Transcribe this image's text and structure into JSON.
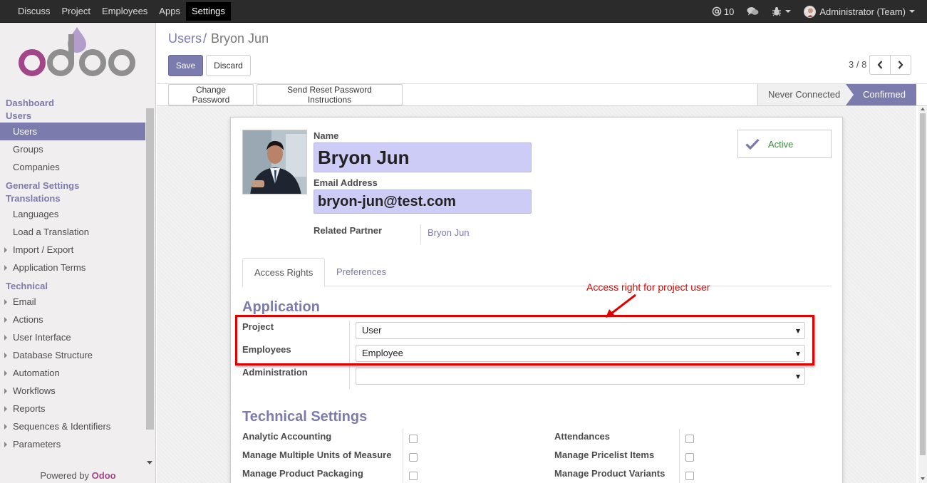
{
  "topbar": {
    "menu": [
      "Discuss",
      "Project",
      "Employees",
      "Apps",
      "Settings"
    ],
    "active_menu": "Settings",
    "messages_count": "10",
    "user": "Administrator (Team)"
  },
  "sidebar": {
    "sections": [
      {
        "title": "Dashboard",
        "items": []
      },
      {
        "title": "Users",
        "items": [
          {
            "label": "Users",
            "active": true
          },
          {
            "label": "Groups"
          },
          {
            "label": "Companies"
          }
        ]
      },
      {
        "title": "General Settings",
        "items": []
      },
      {
        "title": "Translations",
        "items": [
          {
            "label": "Languages"
          },
          {
            "label": "Load a Translation"
          },
          {
            "label": "Import / Export",
            "expandable": true
          },
          {
            "label": "Application Terms",
            "expandable": true
          }
        ]
      },
      {
        "title": "Technical",
        "items": [
          {
            "label": "Email",
            "expandable": true
          },
          {
            "label": "Actions",
            "expandable": true
          },
          {
            "label": "User Interface",
            "expandable": true
          },
          {
            "label": "Database Structure",
            "expandable": true
          },
          {
            "label": "Automation",
            "expandable": true
          },
          {
            "label": "Workflows",
            "expandable": true
          },
          {
            "label": "Reports",
            "expandable": true
          },
          {
            "label": "Sequences & Identifiers",
            "expandable": true
          },
          {
            "label": "Parameters",
            "expandable": true
          }
        ]
      }
    ],
    "powered_prefix": "Powered by",
    "powered_brand": "Odoo"
  },
  "control_panel": {
    "breadcrumb_parent": "Users",
    "breadcrumb_sep": "/",
    "breadcrumb_current": "Bryon Jun",
    "save_label": "Save",
    "discard_label": "Discard",
    "pager": "3 / 8"
  },
  "header": {
    "change_password": "Change Password",
    "send_reset": "Send Reset Password Instructions",
    "stage_never": "Never Connected",
    "stage_confirmed": "Confirmed"
  },
  "form": {
    "name_label": "Name",
    "name_value": "Bryon Jun",
    "email_label": "Email Address",
    "email_value": "bryon-jun@test.com",
    "partner_label": "Related Partner",
    "partner_value": "Bryon Jun",
    "active_label": "Active",
    "tabs": [
      "Access Rights",
      "Preferences"
    ],
    "application_title": "Application",
    "project_label": "Project",
    "project_value": "User",
    "employees_label": "Employees",
    "employees_value": "Employee",
    "administration_label": "Administration",
    "administration_value": "",
    "technical_title": "Technical Settings",
    "technical_left": [
      "Analytic Accounting",
      "Manage Multiple Units of Measure",
      "Manage Product Packaging"
    ],
    "technical_right": [
      "Attendances",
      "Manage Pricelist Items",
      "Manage Product Variants"
    ]
  },
  "annotation": {
    "text": "Access right for project user",
    "color": "#e00000"
  },
  "colors": {
    "brand": "#7c7bad",
    "topbar": "#2b2b2b",
    "field_bg": "#ccccf6"
  }
}
